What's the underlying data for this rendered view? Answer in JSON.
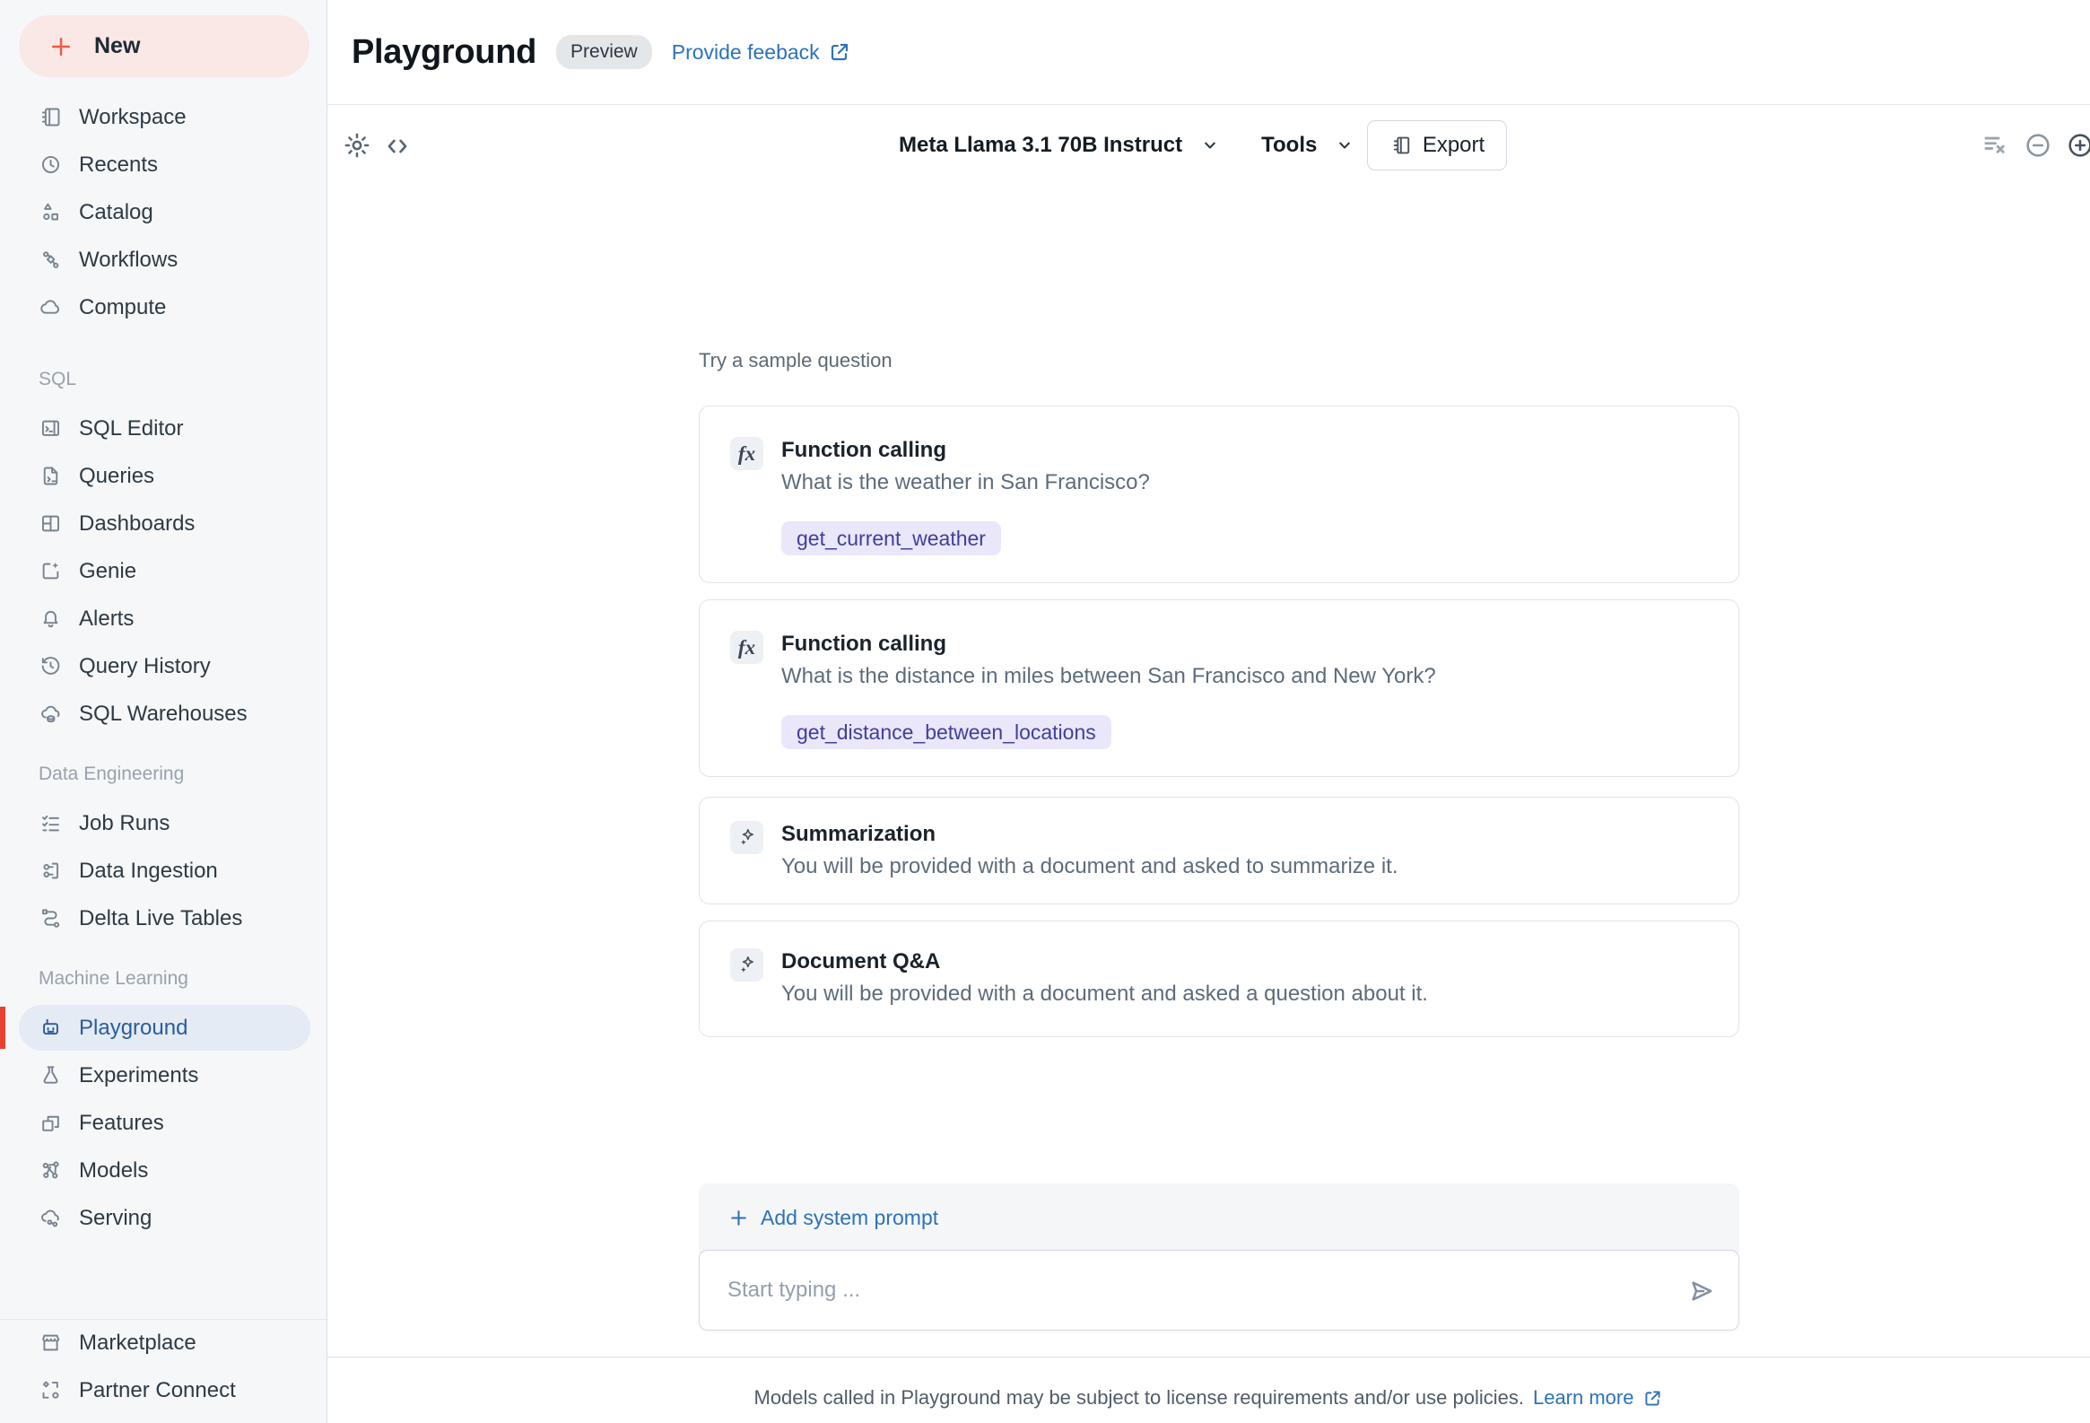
{
  "sidebar": {
    "new_label": "New",
    "sections": [
      {
        "header": null,
        "items": [
          {
            "label": "Workspace",
            "icon": "notebook-icon"
          },
          {
            "label": "Recents",
            "icon": "clock-icon"
          },
          {
            "label": "Catalog",
            "icon": "catalog-icon"
          },
          {
            "label": "Workflows",
            "icon": "workflows-icon"
          },
          {
            "label": "Compute",
            "icon": "cloud-icon"
          }
        ]
      },
      {
        "header": "SQL",
        "items": [
          {
            "label": "SQL Editor",
            "icon": "sql-editor-icon"
          },
          {
            "label": "Queries",
            "icon": "file-code-icon"
          },
          {
            "label": "Dashboards",
            "icon": "dashboard-grid-icon"
          },
          {
            "label": "Genie",
            "icon": "genie-sparkle-icon"
          },
          {
            "label": "Alerts",
            "icon": "bell-icon"
          },
          {
            "label": "Query History",
            "icon": "history-clock-icon"
          },
          {
            "label": "SQL Warehouses",
            "icon": "cloud-db-icon"
          }
        ]
      },
      {
        "header": "Data Engineering",
        "items": [
          {
            "label": "Job Runs",
            "icon": "checklist-icon"
          },
          {
            "label": "Data Ingestion",
            "icon": "ingestion-icon"
          },
          {
            "label": "Delta Live Tables",
            "icon": "pipeline-icon"
          }
        ]
      },
      {
        "header": "Machine Learning",
        "items": [
          {
            "label": "Playground",
            "icon": "robot-icon",
            "active": true
          },
          {
            "label": "Experiments",
            "icon": "flask-icon"
          },
          {
            "label": "Features",
            "icon": "feature-boxes-icon"
          },
          {
            "label": "Models",
            "icon": "model-graph-icon"
          },
          {
            "label": "Serving",
            "icon": "cloud-serving-icon"
          }
        ]
      }
    ],
    "bottom_items": [
      {
        "label": "Marketplace",
        "icon": "storefront-icon"
      },
      {
        "label": "Partner Connect",
        "icon": "partner-connect-icon"
      }
    ]
  },
  "header": {
    "title": "Playground",
    "badge": "Preview",
    "feedback_link": "Provide feeback"
  },
  "toolbar": {
    "model_selected": "Meta Llama 3.1 70B Instruct",
    "tools_label": "Tools",
    "export_label": "Export"
  },
  "content": {
    "hint": "Try a sample question",
    "cards": [
      {
        "icon": "function-icon",
        "title": "Function calling",
        "description": "What is the weather in San Francisco?",
        "tag": "get_current_weather"
      },
      {
        "icon": "function-icon",
        "title": "Function calling",
        "description": "What is the distance in miles between San Francisco and New York?",
        "tag": "get_distance_between_locations"
      },
      {
        "icon": "sparkles-icon",
        "title": "Summarization",
        "description": "You will be provided with a document and asked to summarize it.",
        "tag": null
      },
      {
        "icon": "sparkles-icon",
        "title": "Document Q&A",
        "description": "You will be provided with a document and asked a question about it.",
        "tag": null
      }
    ]
  },
  "composer": {
    "add_system_prompt": "Add system prompt",
    "placeholder": "Start typing ..."
  },
  "footer": {
    "text": "Models called in Playground may be subject to license requirements and/or use policies.",
    "link": "Learn more"
  },
  "colors": {
    "accent_red": "#e8412f",
    "link_blue": "#2d72b8",
    "active_blue": "#2a5c9c",
    "tag_purple_text": "#403f9c",
    "tag_purple_bg": "#e9e7f9",
    "sidebar_bg": "#f6f7f9"
  }
}
